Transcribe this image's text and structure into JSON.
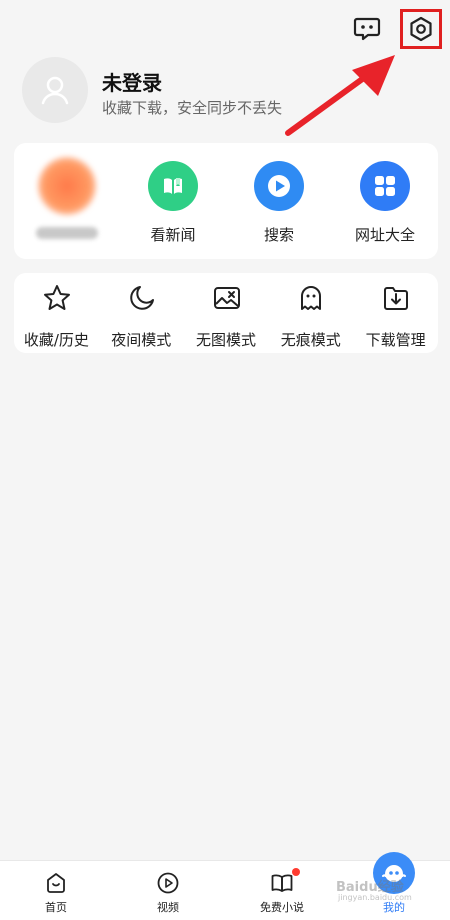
{
  "profile": {
    "name": "未登录",
    "subtitle": "收藏下载，安全同步不丢失"
  },
  "apps": [
    {
      "label": "",
      "icon": "blurred-app-icon",
      "color": "#ff7a4a"
    },
    {
      "label": "看新闻",
      "icon": "news-book-icon",
      "color": "#2fcf86"
    },
    {
      "label": "搜索",
      "icon": "search-play-icon",
      "color": "#2f8bf3"
    },
    {
      "label": "网址大全",
      "icon": "grid-apps-icon",
      "color": "#2f7cf6"
    }
  ],
  "tools": [
    {
      "label": "收藏/历史",
      "icon": "star-icon"
    },
    {
      "label": "夜间模式",
      "icon": "moon-icon"
    },
    {
      "label": "无图模式",
      "icon": "no-image-icon"
    },
    {
      "label": "无痕模式",
      "icon": "ghost-icon"
    },
    {
      "label": "下载管理",
      "icon": "download-icon"
    }
  ],
  "nav": [
    {
      "label": "首页",
      "icon": "home-icon"
    },
    {
      "label": "视频",
      "icon": "video-icon"
    },
    {
      "label": "免费小说",
      "icon": "book-icon"
    },
    {
      "label": "我的",
      "icon": "mine-icon",
      "active": true
    }
  ],
  "watermark": {
    "text": "Baidu经验",
    "sub": "jingyan.baidu.com"
  },
  "colors": {
    "accent": "#2f7cf6",
    "highlight": "#e02020"
  }
}
